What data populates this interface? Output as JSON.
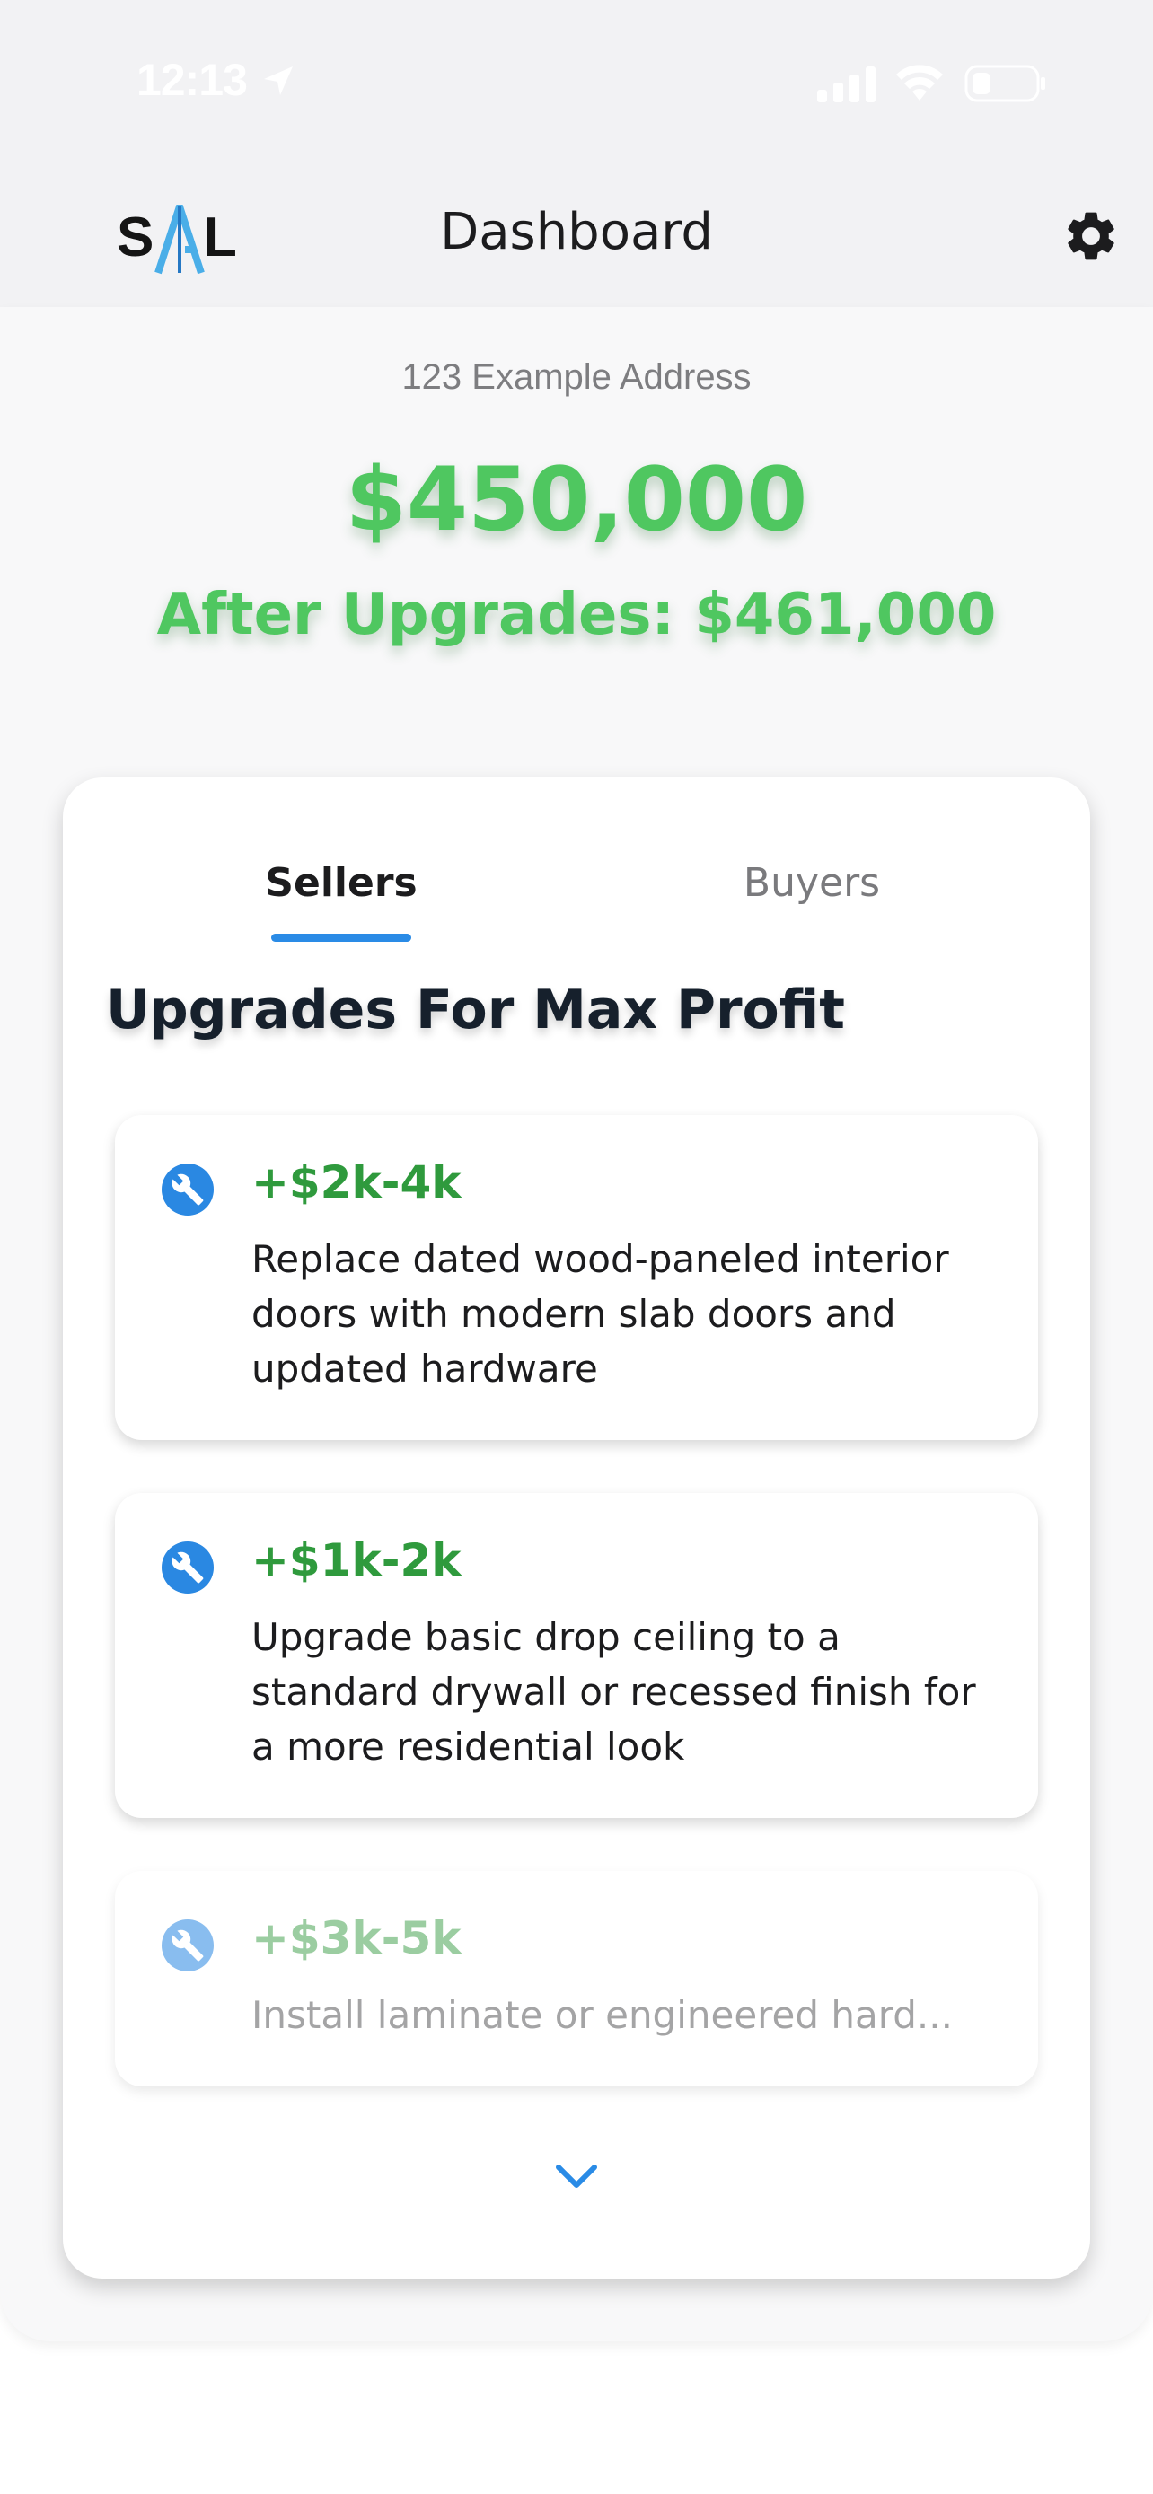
{
  "status_bar": {
    "time": "12:13"
  },
  "header": {
    "logo_left": "S",
    "logo_right": "L",
    "title": "Dashboard",
    "settings_icon": "gear-icon"
  },
  "property": {
    "address": "123 Example Address",
    "price": "$450,000",
    "after_upgrades": "After Upgrades: $461,000"
  },
  "tabs": [
    {
      "label": "Sellers",
      "active": true
    },
    {
      "label": "Buyers",
      "active": false
    }
  ],
  "section": {
    "heading": "Upgrades For Max Profit"
  },
  "upgrades": [
    {
      "icon": "wrench-icon",
      "value": "+$2k-4k",
      "description": "Replace dated wood-paneled interior doors with modern slab doors and updated hardware"
    },
    {
      "icon": "wrench-icon",
      "value": "+$1k-2k",
      "description": "Upgrade basic drop ceiling to a standard drywall or recessed finish for a more residential look"
    },
    {
      "icon": "wrench-icon",
      "value": "+$3k-5k",
      "description": "Install laminate or engineered hard..."
    }
  ],
  "colors": {
    "price_green": "#4fc760",
    "value_green": "#2f9a3d",
    "accent_blue": "#2a8be6"
  },
  "expand_icon": "chevron-down-icon"
}
